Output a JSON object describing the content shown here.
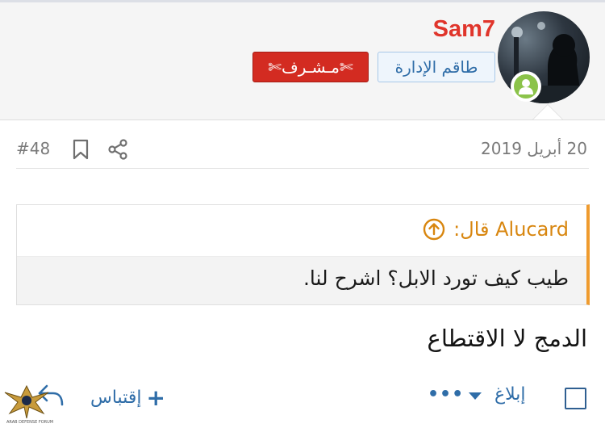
{
  "user": {
    "name": "Sam7",
    "banner_staff": "طاقم الإدارة",
    "banner_moderator": "✄مـشـرف✄"
  },
  "post": {
    "date": "20 أبريل 2019",
    "number": "#48"
  },
  "quote": {
    "author": "Alucard قال:",
    "text": "طيب كيف تورد الابل؟ اشرح لنا."
  },
  "message": "الدمج لا الاقتطاع",
  "actions": {
    "report": "إبلاغ",
    "more": "•••",
    "quote": "إقتباس",
    "quote_plus": "+"
  },
  "watermark": {
    "line1": "ARAB DEFENSE FORUM"
  },
  "colors": {
    "username": "#e0352b",
    "link": "#2f6da8",
    "quote_accent": "#ef9b2e",
    "online": "#8bc34a",
    "moderator_banner": "#d32b21"
  },
  "icons": {
    "online": "user-online-icon",
    "bookmark": "bookmark-icon",
    "share": "share-icon",
    "quote_jump": "arrow-up-circle-icon",
    "reply": "reply-arrow-icon"
  }
}
